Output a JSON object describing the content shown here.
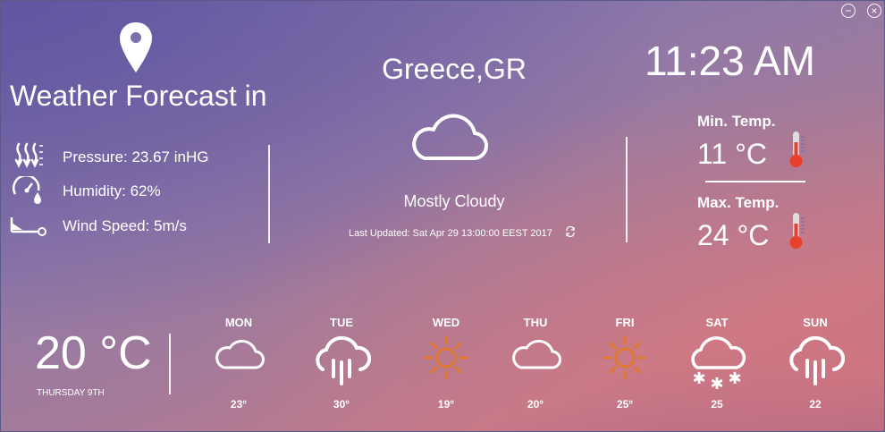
{
  "window": {
    "minimize_icon": "minus-circle-icon",
    "close_icon": "close-circle-icon"
  },
  "header": {
    "title": "Weather Forecast in",
    "location_icon": "map-pin-icon"
  },
  "details": {
    "pressure": "Pressure: 23.67 inHG",
    "humidity": "Humidity: 62%",
    "wind": "Wind Speed: 5m/s"
  },
  "current": {
    "city": "Greece,GR",
    "condition": "Mostly Cloudy",
    "last_updated": "Last Updated: Sat Apr 29 13:00:00 EEST 2017",
    "refresh_icon": "refresh-icon"
  },
  "clock": {
    "time": "11:23 AM"
  },
  "minmax": {
    "min_label": "Min. Temp.",
    "min_value": "11 °C",
    "max_label": "Max. Temp.",
    "max_value": "24 °C"
  },
  "today": {
    "temp": "20 °C",
    "date": "THURSDAY 9TH"
  },
  "forecast": [
    {
      "day": "MON",
      "temp": "23°",
      "icon": "cloud-icon"
    },
    {
      "day": "TUE",
      "temp": "30°",
      "icon": "rain-icon"
    },
    {
      "day": "WED",
      "temp": "19°",
      "icon": "sun-icon"
    },
    {
      "day": "THU",
      "temp": "20°",
      "icon": "cloud-icon"
    },
    {
      "day": "FRI",
      "temp": "25°",
      "icon": "sun-icon"
    },
    {
      "day": "SAT",
      "temp": "25",
      "icon": "snow-icon"
    },
    {
      "day": "SUN",
      "temp": "22",
      "icon": "rain-icon"
    }
  ],
  "colors": {
    "sun": "#e07830",
    "thermo": "#e8402a"
  }
}
